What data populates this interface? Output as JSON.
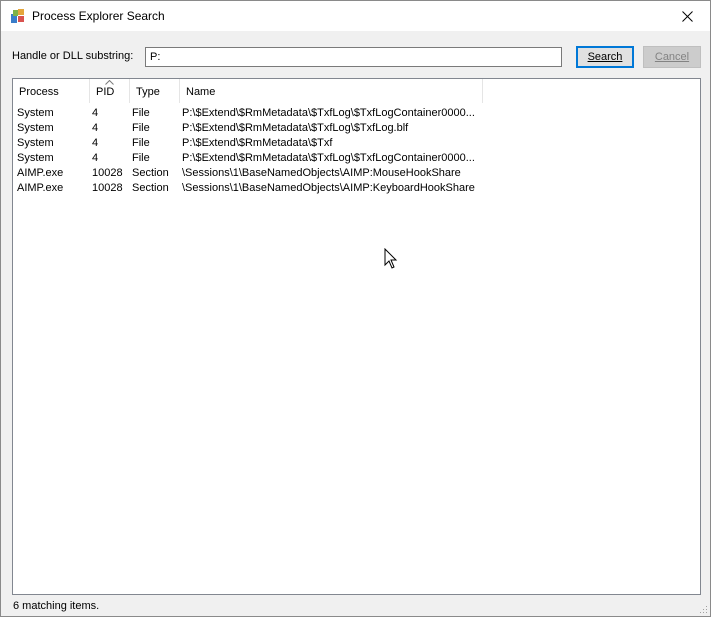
{
  "window": {
    "title": "Process Explorer Search",
    "icon": "process-explorer-icon",
    "close_icon": "close-icon"
  },
  "search": {
    "label": "Handle or DLL substring:",
    "value": "P:",
    "search_label": "Search",
    "cancel_label": "Cancel"
  },
  "table": {
    "columns": [
      "Process",
      "PID",
      "Type",
      "Name"
    ],
    "sorted_column": "PID",
    "rows": [
      {
        "process": "System",
        "pid": "4",
        "type": "File",
        "name": "P:\\$Extend\\$RmMetadata\\$TxfLog\\$TxfLogContainer0000..."
      },
      {
        "process": "System",
        "pid": "4",
        "type": "File",
        "name": "P:\\$Extend\\$RmMetadata\\$TxfLog\\$TxfLog.blf"
      },
      {
        "process": "System",
        "pid": "4",
        "type": "File",
        "name": "P:\\$Extend\\$RmMetadata\\$Txf"
      },
      {
        "process": "System",
        "pid": "4",
        "type": "File",
        "name": "P:\\$Extend\\$RmMetadata\\$TxfLog\\$TxfLogContainer0000..."
      },
      {
        "process": "AIMP.exe",
        "pid": "10028",
        "type": "Section",
        "name": "\\Sessions\\1\\BaseNamedObjects\\AIMP:MouseHookShare"
      },
      {
        "process": "AIMP.exe",
        "pid": "10028",
        "type": "Section",
        "name": "\\Sessions\\1\\BaseNamedObjects\\AIMP:KeyboardHookShare"
      }
    ]
  },
  "status": {
    "text": "6 matching items."
  },
  "colors": {
    "accent": "#0078d7",
    "disabled_text": "#838383"
  }
}
